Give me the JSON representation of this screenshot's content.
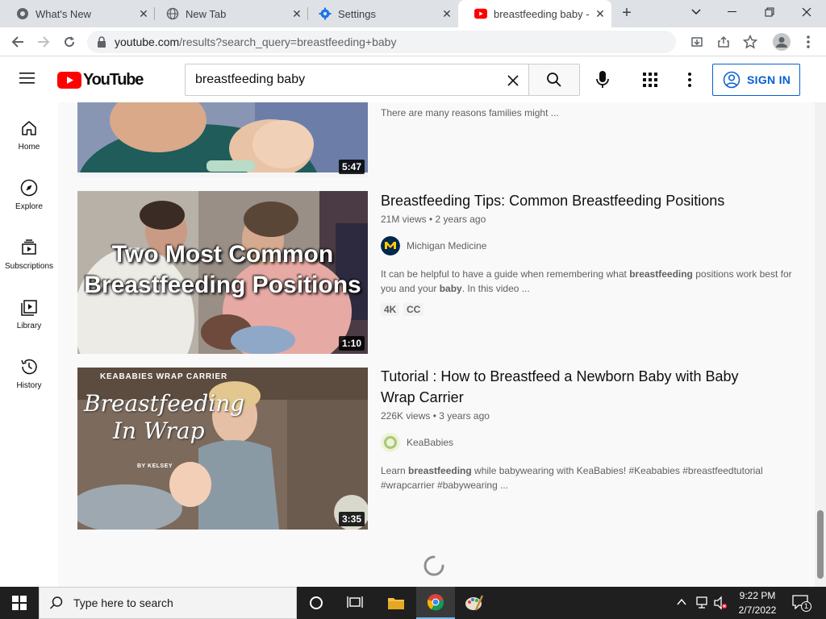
{
  "browser": {
    "tabs": [
      {
        "label": "What's New",
        "icon": "chrome-icon"
      },
      {
        "label": "New Tab",
        "icon": "globe-icon"
      },
      {
        "label": "Settings",
        "icon": "gear-icon"
      },
      {
        "label": "breastfeeding baby - Y",
        "icon": "youtube-icon"
      }
    ],
    "new_tab": "+",
    "url_host": "youtube.com",
    "url_path": "/results?search_query=breastfeeding+baby"
  },
  "youtube": {
    "logo_text": "YouTube",
    "search_value": "breastfeeding baby",
    "sign_in": "SIGN IN",
    "guide": [
      {
        "label": "Home",
        "icon": "home-icon"
      },
      {
        "label": "Explore",
        "icon": "compass-icon"
      },
      {
        "label": "Subscriptions",
        "icon": "subscriptions-icon"
      },
      {
        "label": "Library",
        "icon": "library-icon"
      },
      {
        "label": "History",
        "icon": "history-icon"
      }
    ],
    "results": [
      {
        "duration": "5:47",
        "desc_partial": "There are many reasons families might ..."
      },
      {
        "title": "Breastfeeding Tips: Common Breastfeeding Positions",
        "meta": "21M views • 2 years ago",
        "channel": "Michigan Medicine",
        "desc_parts": [
          "It can be helpful to have a guide when remembering what ",
          "breastfeeding",
          " positions work best for you and your ",
          "baby",
          ". In this video ..."
        ],
        "badges": [
          "4K",
          "CC"
        ],
        "duration": "1:10",
        "thumb_text_1": "Two Most Common",
        "thumb_text_2": "Breastfeeding Positions"
      },
      {
        "title": "Tutorial : How to Breastfeed a Newborn Baby with Baby Wrap Carrier",
        "meta": "226K views • 3 years ago",
        "channel": "KeaBabies",
        "desc_parts": [
          "Learn ",
          "breastfeeding",
          " while babywearing with KeaBabies! #Keababies #breastfeedtutorial #wrapcarrier #babywearing ..."
        ],
        "duration": "3:35",
        "thumb_header": "KEABABIES WRAP CARRIER",
        "thumb_script_1": "Breastfeeding",
        "thumb_script_2": "In Wrap",
        "thumb_by": "BY KELSEY"
      }
    ]
  },
  "taskbar": {
    "search_placeholder": "Type here to search",
    "time": "9:22 PM",
    "date": "2/7/2022",
    "notification_count": "1"
  }
}
